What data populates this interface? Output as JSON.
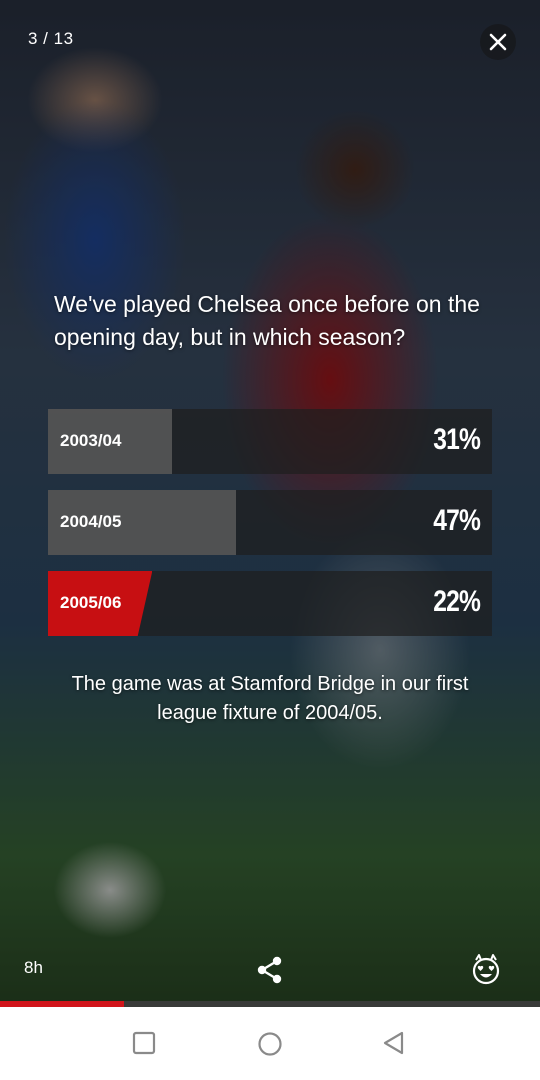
{
  "story": {
    "counter": "3 / 13",
    "question": "We've played Chelsea once before on the opening day, but in which season?",
    "options": [
      {
        "label": "2003/04",
        "percent_text": "31%",
        "percent": 31,
        "selected": false
      },
      {
        "label": "2004/05",
        "percent_text": "47%",
        "percent": 47,
        "selected": false
      },
      {
        "label": "2005/06",
        "percent_text": "22%",
        "percent": 22,
        "selected": true
      }
    ],
    "answer": "The game was at Stamford Bridge in our first league fixture of 2004/05.",
    "posted_ago": "8h",
    "progress": 0.23
  },
  "icons": {
    "close": "close-icon",
    "share": "share-icon",
    "reaction": "heart-eyes-devil-icon",
    "nav_recents": "square-icon",
    "nav_home": "circle-icon",
    "nav_back": "triangle-back-icon"
  },
  "colors": {
    "accent": "#c70f12",
    "option_bg": "#1e1e1e",
    "option_fill": "#5f5f5f",
    "navbar_bg": "#ffffff"
  }
}
